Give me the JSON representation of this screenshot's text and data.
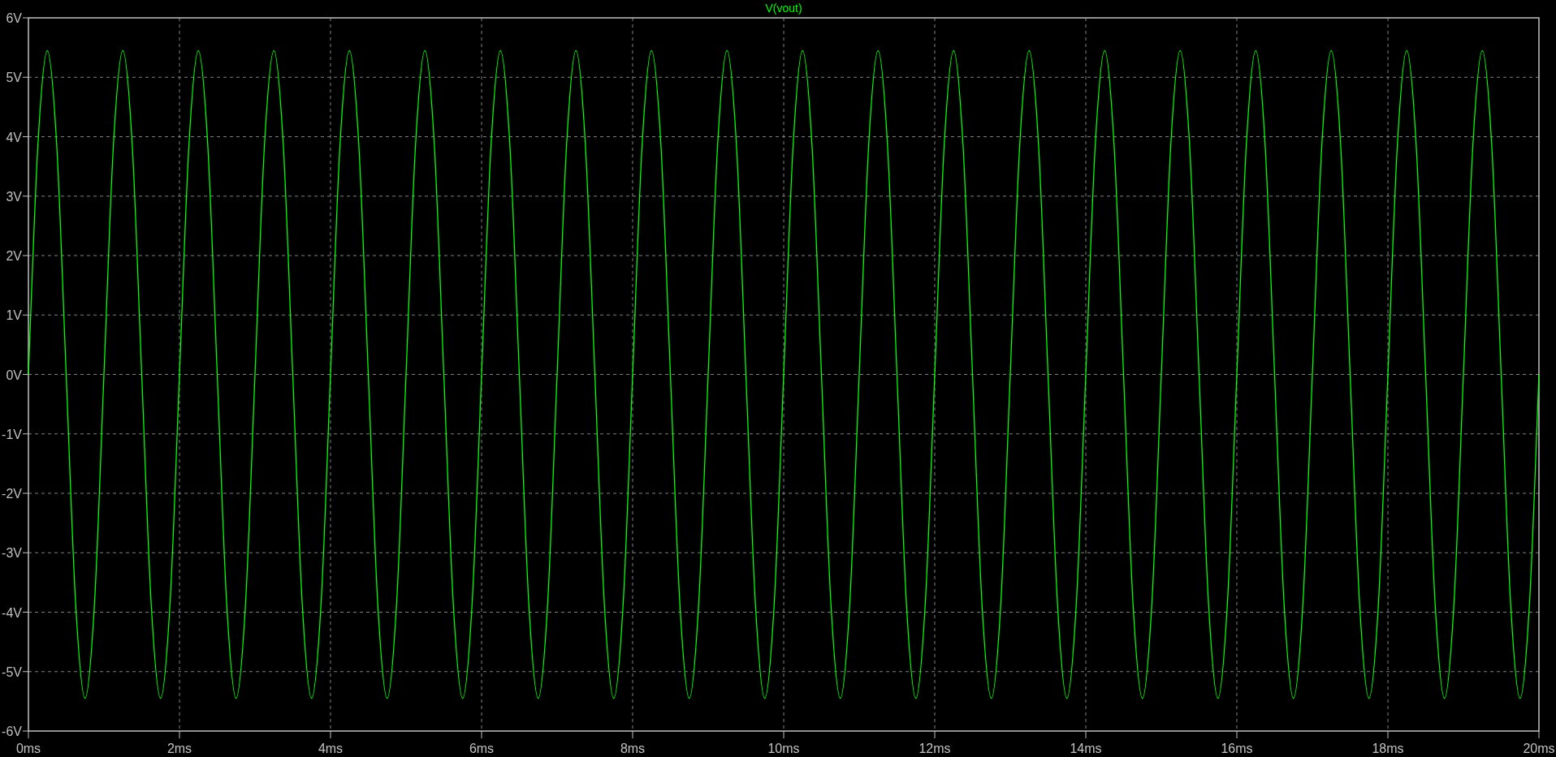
{
  "chart_data": {
    "type": "line",
    "grid": true,
    "xlim": [
      0,
      20
    ],
    "ylim": [
      -6,
      6
    ],
    "xticks": [
      {
        "value": 0,
        "label": "0ms"
      },
      {
        "value": 2,
        "label": "2ms"
      },
      {
        "value": 4,
        "label": "4ms"
      },
      {
        "value": 6,
        "label": "6ms"
      },
      {
        "value": 8,
        "label": "8ms"
      },
      {
        "value": 10,
        "label": "10ms"
      },
      {
        "value": 12,
        "label": "12ms"
      },
      {
        "value": 14,
        "label": "14ms"
      },
      {
        "value": 16,
        "label": "16ms"
      },
      {
        "value": 18,
        "label": "18ms"
      },
      {
        "value": 20,
        "label": "20ms"
      }
    ],
    "yticks": [
      {
        "value": 6,
        "label": "6V"
      },
      {
        "value": 5,
        "label": "5V"
      },
      {
        "value": 4,
        "label": "4V"
      },
      {
        "value": 3,
        "label": "3V"
      },
      {
        "value": 2,
        "label": "2V"
      },
      {
        "value": 1,
        "label": "1V"
      },
      {
        "value": 0,
        "label": "0V"
      },
      {
        "value": -1,
        "label": "-1V"
      },
      {
        "value": -2,
        "label": "-2V"
      },
      {
        "value": -3,
        "label": "-3V"
      },
      {
        "value": -4,
        "label": "-4V"
      },
      {
        "value": -5,
        "label": "-5V"
      },
      {
        "value": -6,
        "label": "-6V"
      }
    ],
    "x": [
      0,
      0.125,
      0.25,
      0.375,
      0.5,
      0.625,
      0.75,
      0.875,
      1,
      1.125,
      1.25,
      1.375,
      1.5,
      1.625,
      1.75,
      1.875,
      2,
      2.125,
      2.25,
      2.375,
      2.5,
      2.625,
      2.75,
      2.875,
      3,
      3.125,
      3.25,
      3.375,
      3.5,
      3.625,
      3.75,
      3.875,
      4,
      4.125,
      4.25,
      4.375,
      4.5,
      4.625,
      4.75,
      4.875,
      5,
      5.125,
      5.25,
      5.375,
      5.5,
      5.625,
      5.75,
      5.875,
      6,
      6.125,
      6.25,
      6.375,
      6.5,
      6.625,
      6.75,
      6.875,
      7,
      7.125,
      7.25,
      7.375,
      7.5,
      7.625,
      7.75,
      7.875,
      8,
      8.125,
      8.25,
      8.375,
      8.5,
      8.625,
      8.75,
      8.875,
      9,
      9.125,
      9.25,
      9.375,
      9.5,
      9.625,
      9.75,
      9.875,
      10,
      10.125,
      10.25,
      10.375,
      10.5,
      10.625,
      10.75,
      10.875,
      11,
      11.125,
      11.25,
      11.375,
      11.5,
      11.625,
      11.75,
      11.875,
      12,
      12.125,
      12.25,
      12.375,
      12.5,
      12.625,
      12.75,
      12.875,
      13,
      13.125,
      13.25,
      13.375,
      13.5,
      13.625,
      13.75,
      13.875,
      14,
      14.125,
      14.25,
      14.375,
      14.5,
      14.625,
      14.75,
      14.875,
      15,
      15.125,
      15.25,
      15.375,
      15.5,
      15.625,
      15.75,
      15.875,
      16,
      16.125,
      16.25,
      16.375,
      16.5,
      16.625,
      16.75,
      16.875,
      17,
      17.125,
      17.25,
      17.375,
      17.5,
      17.625,
      17.75,
      17.875,
      18,
      18.125,
      18.25,
      18.375,
      18.5,
      18.625,
      18.75,
      18.875,
      19,
      19.125,
      19.25,
      19.375,
      19.5,
      19.625,
      19.75,
      19.875,
      20
    ],
    "series": [
      {
        "name": "V(vout)",
        "color": "#00ff00",
        "values": [
          0,
          3.85,
          5.45,
          3.85,
          0,
          -3.85,
          -5.45,
          -3.85,
          0,
          3.85,
          5.45,
          3.85,
          0,
          -3.85,
          -5.45,
          -3.85,
          0,
          3.85,
          5.45,
          3.85,
          0,
          -3.85,
          -5.45,
          -3.85,
          0,
          3.85,
          5.45,
          3.85,
          0,
          -3.85,
          -5.45,
          -3.85,
          0,
          3.85,
          5.45,
          3.85,
          0,
          -3.85,
          -5.45,
          -3.85,
          0,
          3.85,
          5.45,
          3.85,
          0,
          -3.85,
          -5.45,
          -3.85,
          0,
          3.85,
          5.45,
          3.85,
          0,
          -3.85,
          -5.45,
          -3.85,
          0,
          3.85,
          5.45,
          3.85,
          0,
          -3.85,
          -5.45,
          -3.85,
          0,
          3.85,
          5.45,
          3.85,
          0,
          -3.85,
          -5.45,
          -3.85,
          0,
          3.85,
          5.45,
          3.85,
          0,
          -3.85,
          -5.45,
          -3.85,
          0,
          3.85,
          5.45,
          3.85,
          0,
          -3.85,
          -5.45,
          -3.85,
          0,
          3.85,
          5.45,
          3.85,
          0,
          -3.85,
          -5.45,
          -3.85,
          0,
          3.85,
          5.45,
          3.85,
          0,
          -3.85,
          -5.45,
          -3.85,
          0,
          3.85,
          5.45,
          3.85,
          0,
          -3.85,
          -5.45,
          -3.85,
          0,
          3.85,
          5.45,
          3.85,
          0,
          -3.85,
          -5.45,
          -3.85,
          0,
          3.85,
          5.45,
          3.85,
          0,
          -3.85,
          -5.45,
          -3.85,
          0,
          3.85,
          5.45,
          3.85,
          0,
          -3.85,
          -5.45,
          -3.85,
          0,
          3.85,
          5.45,
          3.85,
          0,
          -3.85,
          -5.45,
          -3.85,
          0,
          3.85,
          5.45,
          3.85,
          0,
          -3.85,
          -5.45,
          -3.85,
          0,
          3.85,
          5.45,
          3.85,
          0,
          -3.85,
          -5.45,
          -3.85,
          0
        ]
      }
    ]
  }
}
